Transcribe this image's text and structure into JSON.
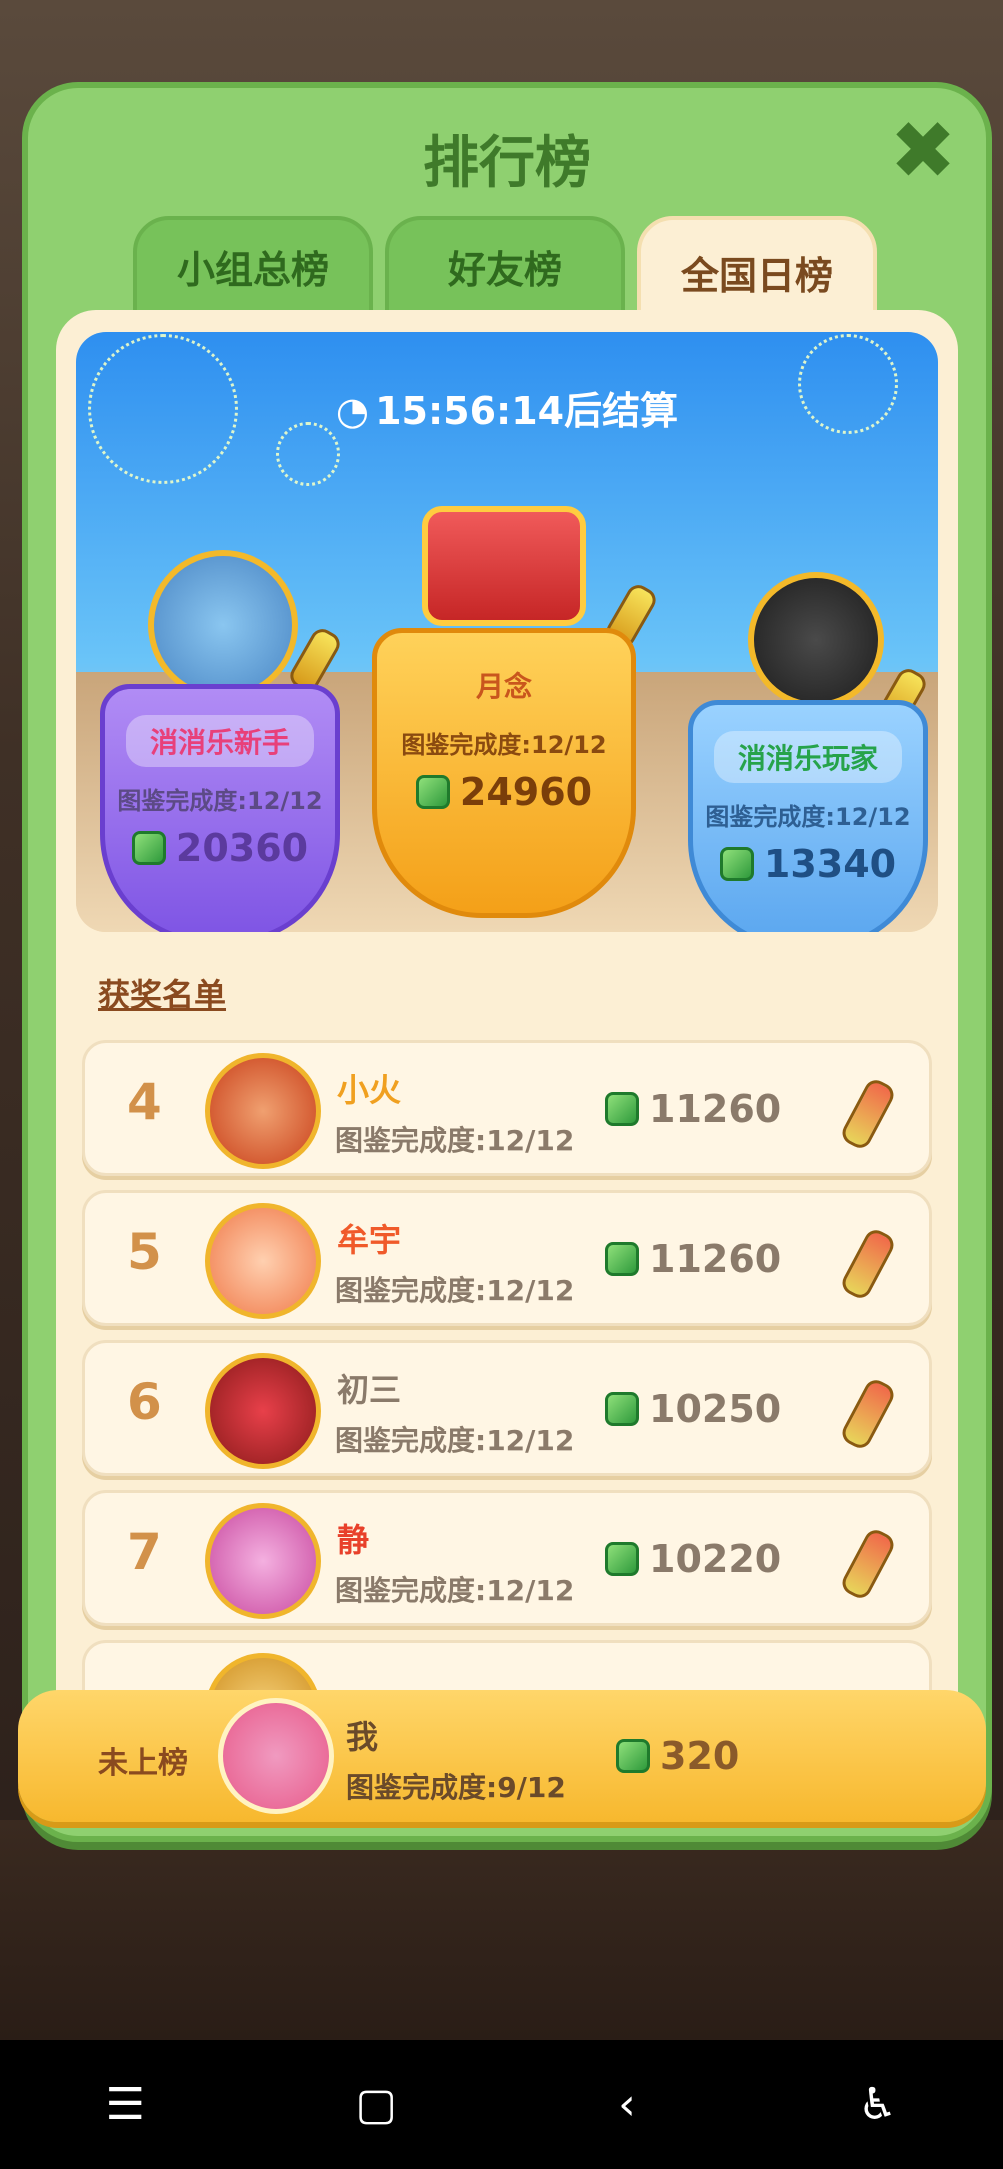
{
  "modal": {
    "title": "排行榜",
    "tabs": [
      {
        "label": "小组总榜",
        "active": false
      },
      {
        "label": "好友榜",
        "active": false
      },
      {
        "label": "全国日榜",
        "active": true
      }
    ]
  },
  "hero": {
    "timer": "15:56:14后结算",
    "podium": [
      {
        "place": 2,
        "name": "消消乐新手",
        "progress": "图鉴完成度:12/12",
        "score": "20360"
      },
      {
        "place": 1,
        "name": "月念",
        "progress": "图鉴完成度:12/12",
        "score": "24960"
      },
      {
        "place": 3,
        "name": "消消乐玩家",
        "progress": "图鉴完成度:12/12",
        "score": "13340"
      }
    ]
  },
  "list": {
    "title": "获奖名单",
    "rows": [
      {
        "rank": "4",
        "name": "小火",
        "progress": "图鉴完成度:12/12",
        "score": "11260",
        "name_color": "#f0a020"
      },
      {
        "rank": "5",
        "name": "牟宇",
        "progress": "图鉴完成度:12/12",
        "score": "11260",
        "name_color": "#f05a2a"
      },
      {
        "rank": "6",
        "name": "初三",
        "progress": "图鉴完成度:12/12",
        "score": "10250",
        "name_color": "#8a7a6a"
      },
      {
        "rank": "7",
        "name": "静",
        "progress": "图鉴完成度:12/12",
        "score": "10220",
        "name_color": "#e8402a"
      }
    ]
  },
  "me": {
    "rank": "未上榜",
    "name": "我",
    "progress": "图鉴完成度:9/12",
    "score": "320"
  },
  "colors": {
    "frame_green": "#8fd070",
    "panel_cream": "#fcefd4",
    "gold": "#f7b82e"
  }
}
